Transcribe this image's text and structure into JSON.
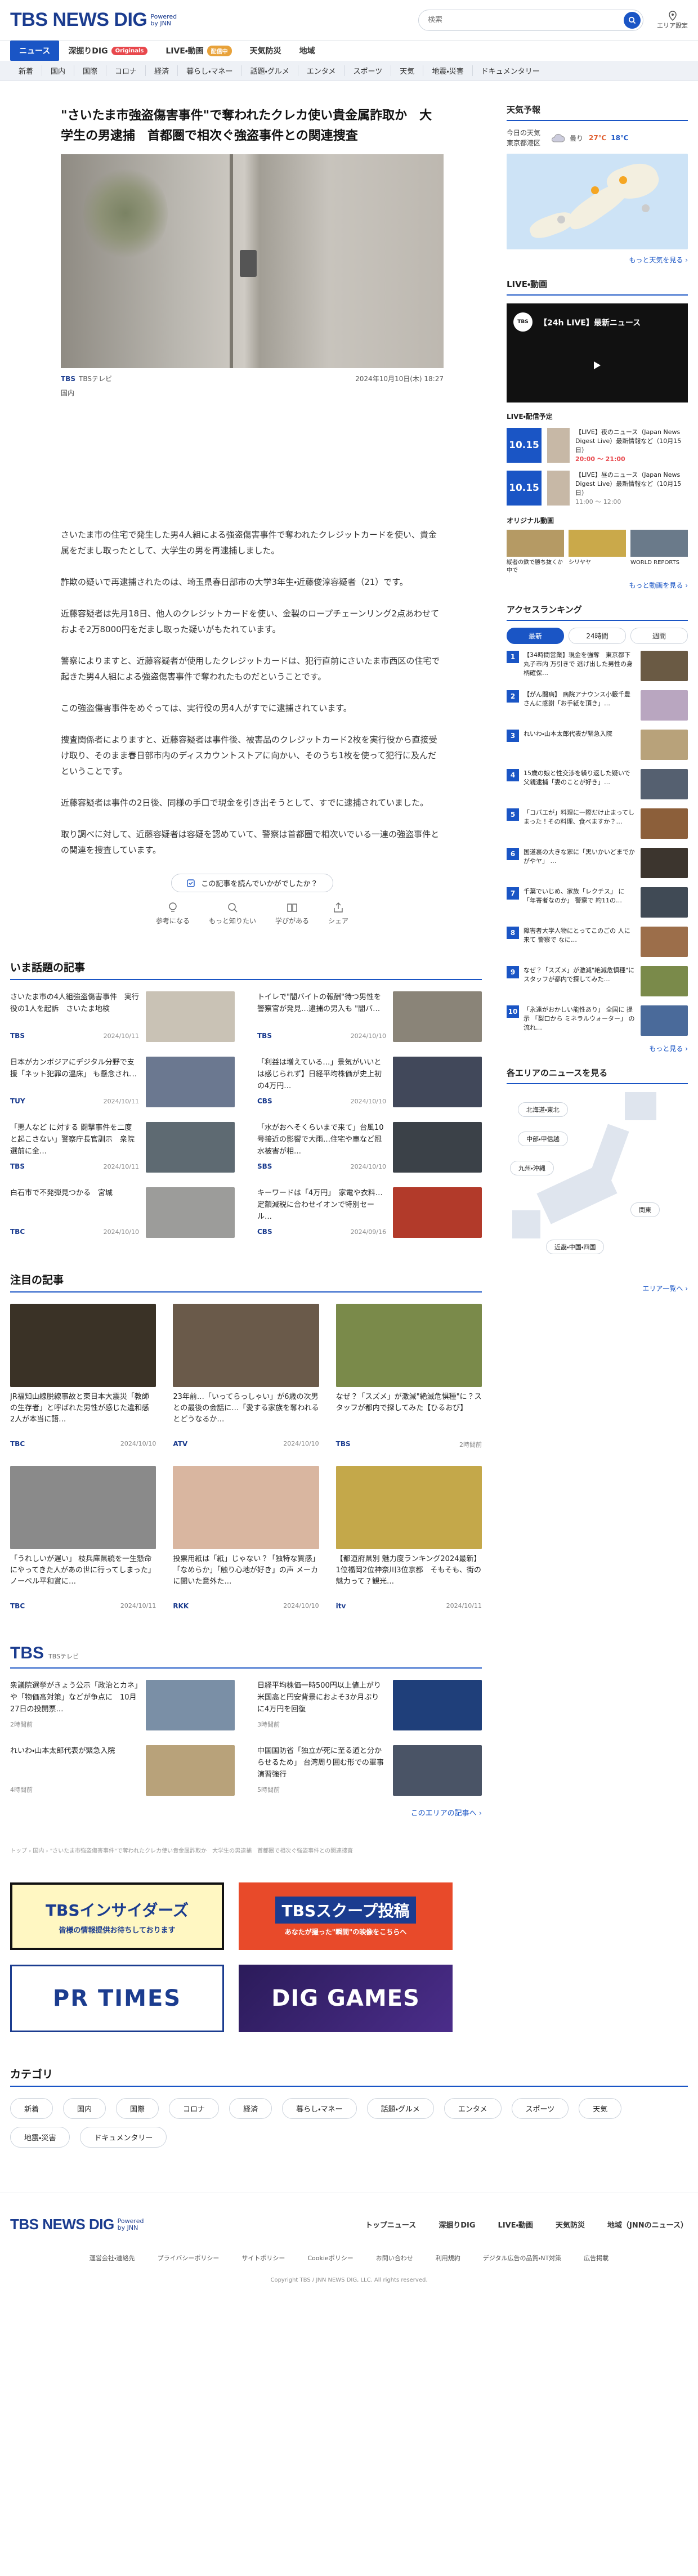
{
  "header": {
    "logo": "TBS NEWS DIG",
    "logo_sub_1": "Powered",
    "logo_sub_2": "by JNN",
    "search_placeholder": "検索",
    "area_label": "エリア設定"
  },
  "nav_main": [
    {
      "label": "ニュース",
      "active": true
    },
    {
      "label": "深掘りDIG",
      "badge": "Originals",
      "badge_color": "#e8484d"
    },
    {
      "label": "LIVE・動画",
      "badge": "配信中",
      "badge_color": "#e8a23a"
    },
    {
      "label": "天気防災"
    },
    {
      "label": "地域"
    }
  ],
  "nav_sub": [
    "新着",
    "国内",
    "国際",
    "コロナ",
    "経済",
    "暮らし・マネー",
    "話題・グルメ",
    "エンタメ",
    "スポーツ",
    "天気",
    "地震・災害",
    "ドキュメンタリー"
  ],
  "article": {
    "title": "\"さいたま市強盗傷害事件\"で奪われたクレカ使い貴金属詐取か　大学生の男逮捕　首都圏で相次ぐ強盗事件との関連捜査",
    "source": "TBSテレビ",
    "datetime": "2024年10月10日(木) 18:27",
    "category": "国内",
    "paragraphs": [
      "さいたま市の住宅で発生した男4人組による強盗傷害事件で奪われたクレジットカードを使い、貴金属をだまし取ったとして、大学生の男を再逮捕しました。",
      "詐欺の疑いで再逮捕されたのは、埼玉県春日部市の大学3年生・近藤俊淳容疑者（21）です。",
      "近藤容疑者は先月18日、他人のクレジットカードを使い、金製のロープチェーンリング2点あわせておよそ2万8000円をだまし取った疑いがもたれています。",
      "警察によりますと、近藤容疑者が使用したクレジットカードは、犯行直前にさいたま市西区の住宅で起きた男4人組による強盗傷害事件で奪われたものだということです。",
      "この強盗傷害事件をめぐっては、実行役の男4人がすでに逮捕されています。",
      "捜査関係者によりますと、近藤容疑者は事件後、被害品のクレジットカード2枚を実行役から直接受け取り、そのまま春日部市内のディスカウントストアに向かい、そのうち1枚を使って犯行に及んだということです。",
      "近藤容疑者は事件の2日後、同様の手口で現金を引き出そうとして、すでに逮捕されていました。",
      "取り調べに対して、近藤容疑者は容疑を認めていて、警察は首都圏で相次いでいる一連の強盗事件との関連を捜査しています。"
    ],
    "feedback_button": "この記事を読んでいかがでしたか？",
    "reactions": [
      "参考になる",
      "もっと知りたい",
      "学びがある",
      "シェア"
    ]
  },
  "trending": {
    "heading": "いま話題の記事",
    "items": [
      {
        "title": "さいたま市の4人組強盗傷害事件　実行役の1人を起訴　さいたま地検",
        "source": "TBS",
        "date": "2024/10/11",
        "thumb": "#c9c2b5"
      },
      {
        "title": "トイレで\"闇バイトの報酬\"待つ男性を警察官が発見…逮捕の男入も \"闇バ…",
        "source": "TBS",
        "date": "2024/10/10",
        "thumb": "#8a8478"
      },
      {
        "title": "日本がカンボジアにデジタル分野で支援「ネット犯罪の温床」 も懸念され…",
        "source": "TUY",
        "date": "2024/10/11",
        "thumb": "#6b7890"
      },
      {
        "title": "「利益は増えている…」景気がいいとは感じられず】日経平均株価が史上初の4万円…",
        "source": "CBS",
        "date": "2024/10/10",
        "thumb": "#41485a"
      },
      {
        "title": "「悪人など に対する 闘撃事件を二度と起こさない」警察庁長官訓示　衆院選前に全…",
        "source": "TBS",
        "date": "2024/10/11",
        "thumb": "#5e6a72"
      },
      {
        "title": "「水がおへそくらいまで来て」台風10号接近の影響で大雨…住宅や車など冠水被害が相…",
        "source": "SBS",
        "date": "2024/10/10",
        "thumb": "#3b4148"
      },
      {
        "title": "白石市で不発弾見つかる　宮城",
        "source": "TBC",
        "date": "2024/10/10",
        "thumb": "#9c9c9a"
      },
      {
        "title": "キーワードは「4万円」　家電や衣料…　定額減税に合わせイオンで特別セール…",
        "source": "CBS",
        "date": "2024/09/16",
        "thumb": "#b23a2a"
      }
    ]
  },
  "featured": {
    "heading": "注目の記事",
    "items": [
      {
        "title": "JR福知山線脱線事故と東日本大震災「教師の生存者」と呼ばれた男性が感じた違和感　2人が本当に語…",
        "source": "TBC",
        "date": "2024/10/10",
        "image": "#3a3226"
      },
      {
        "title": "23年前…「いってらっしゃい」が6歳の次男との最後の会話に…「愛する家族を奪われるとどうなるか…",
        "source": "ATV",
        "date": "2024/10/10",
        "image": "#6a5a4a"
      },
      {
        "title": "なぜ？「スズメ」が激減\"絶滅危惧種\"に？スタッフが都内で探してみた【ひるおび】",
        "source": "TBS",
        "date": "2時間前",
        "image": "#7a8a4a"
      },
      {
        "title": "「うれしいが遅い」 枝兵庫県統を一生懸命にやってきた人があの世に行ってしまった」ノーベル平和賞に…",
        "source": "TBC",
        "date": "2024/10/11",
        "image": "#8a8a8a"
      },
      {
        "title": "投票用紙は「紙」じゃない？「独特な質感」「なめらか」「触り心地が好き」の声 メーカに聞いた意外た…",
        "source": "RKK",
        "date": "2024/10/10",
        "image": "#d9b6a0"
      },
      {
        "title": "【都道府県別 魅力度ランキング2024最新】1位福岡2位神奈川3位京都　そもそも、街の魅力って？観光…",
        "source": "itv",
        "date": "2024/10/11",
        "image": "#c4a84a"
      }
    ]
  },
  "tbs_section": {
    "heading": "TBS",
    "sub": "TBSテレビ",
    "items": [
      {
        "title": "衆議院選挙がきょう公示「政治とカネ」や「物価高対策」などが争点に　10月27日の投開票…",
        "date": "2時間前",
        "thumb": "#7a8fa6"
      },
      {
        "title": "日経平均株価一時500円以上値上がり　米国高と円安背景におよそ3か月ぶりに4万円を回復",
        "date": "3時間前",
        "thumb": "#1f3f7a"
      },
      {
        "title": "れいわ・山本太郎代表が緊急入院",
        "date": "4時間前",
        "thumb": "#b8a27a"
      },
      {
        "title": "中国国防省「独立が死に至る道と分からせるため」 台湾周り囲む形での軍事演習強行",
        "date": "5時間前",
        "thumb": "#4a5466"
      }
    ],
    "more": "このエリアの記事へ ›"
  },
  "breadcrumb": "トップ › 国内 › \"さいたま市強盗傷害事件\"で奪われたクレカ使い貴金属詐取か　大学生の男逮捕　首都圏で相次ぐ強盗事件との関連捜査",
  "banners": [
    {
      "text": "TBSインサイダーズ",
      "sub": "皆様の情報提供お待ちしております",
      "bg": "#fff7c2",
      "fg": "#1b3c8f"
    },
    {
      "text": "TBSスクープ投稿",
      "sub": "あなたが撮った\"瞬間\"の映像をこちらへ",
      "bg": "#1b3c8f",
      "fg": "#ffffff"
    },
    {
      "text": "PR TIMES",
      "bg": "#ffffff",
      "fg": "#1b3c8f"
    },
    {
      "text": "DIG GAMES",
      "bg": "#2b1b5a",
      "fg": "#ffffff"
    }
  ],
  "categories": {
    "heading": "カテゴリ",
    "items": [
      "新着",
      "国内",
      "国際",
      "コロナ",
      "経済",
      "暮らし・マネー",
      "話題・グルメ",
      "エンタメ",
      "スポーツ",
      "天気",
      "地震・災害",
      "ドキュメンタリー"
    ]
  },
  "footer": {
    "nav": [
      "トップニュース",
      "深掘りDIG",
      "LIVE・動画",
      "天気防災",
      "地域（JNNのニュース）"
    ],
    "links": [
      "運営会社・連絡先",
      "プライバシーポリシー",
      "サイトポリシー",
      "Cookieポリシー",
      "お問い合わせ",
      "利用規約",
      "デジタル広告の品質・NT対策",
      "広告掲載"
    ],
    "copyright": "Copyright TBS / JNN NEWS DIG, LLC. All rights reserved."
  },
  "sidebar": {
    "weather": {
      "heading": "天気予報",
      "today": "今日の天気",
      "region": "東京都港区",
      "condition": "曇り",
      "high": "27℃",
      "low": "18℃",
      "more": "もっと天気を見る ›"
    },
    "live": {
      "heading": "LIVE・動画",
      "title": "【24h LIVE】最新ニュース",
      "schedule_heading": "LIVE・配信予定",
      "items": [
        {
          "time": "10.15",
          "title": "【LIVE】夜のニュース（Japan News Digest Live）最新情報など（10月15日）",
          "state": "20:00 〜 21:00"
        },
        {
          "time": "10.15",
          "title": "【LIVE】昼のニュース（Japan News Digest Live）最新情報など（10月15日）",
          "state": "11:00 〜 12:00"
        }
      ],
      "original_heading": "オリジナル動画",
      "originals": [
        "縦者の鉄で勝ち抜くか中で",
        "シリヤヤ",
        "WORLD REPORTS"
      ],
      "more": "もっと動画を見る ›"
    },
    "ranking": {
      "heading": "アクセスランキング",
      "tabs": [
        "最新",
        "24時間",
        "週間"
      ],
      "items": [
        {
          "rank": "1",
          "title": "【34時間営業】現金を強奪　東京都下丸子市内 万引きで 逃げ出した男性の身柄確保…",
          "thumb": "#6a5a44"
        },
        {
          "rank": "2",
          "title": "【がん闘病】 病院アナウンス小籔千豊さんに感謝「お手紙を頂き」…",
          "thumb": "#b9a6c0"
        },
        {
          "rank": "3",
          "title": "れいわ・山本太郎代表が緊急入院",
          "thumb": "#b8a27a"
        },
        {
          "rank": "4",
          "title": "15歳の娘と性交渉を繰り返した疑いで父親逮捕「妻のことが好き」…",
          "thumb": "#556070"
        },
        {
          "rank": "5",
          "title": "「コバエが」料理に一際だけ止まってしまった！その料理、食べますか？…",
          "thumb": "#8c5f3a"
        },
        {
          "rank": "6",
          "title": "国道裏の大きな家に「黒いかいどまでかがやヤ」 …",
          "thumb": "#3c352e"
        },
        {
          "rank": "7",
          "title": "千葉でいじめ、家族「レクチス」 に「年寄者なのか」 警察で 約11の…",
          "thumb": "#404a55"
        },
        {
          "rank": "8",
          "title": "障害者大学人物にとってこのごの 人に来て 警察で なに…",
          "thumb": "#9c6e4a"
        },
        {
          "rank": "9",
          "title": "なぜ？「スズメ」が激減\"絶滅危惧種\"にスタッフが都内で探してみた…",
          "thumb": "#7a8a4a"
        },
        {
          "rank": "10",
          "title": "「永遠がおかしい能性あり」 全国に 提示 「梨口から ミネラルウォーター」 の 流れ…",
          "thumb": "#4a6a9a"
        }
      ],
      "more": "もっと見る ›"
    },
    "area": {
      "heading": "各エリアのニュースを見る",
      "regions": [
        "北海道・東北",
        "中部・甲信越",
        "九州・沖縄",
        "関東",
        "近畿・中国・四国"
      ],
      "more": "エリア一覧へ ›"
    }
  }
}
